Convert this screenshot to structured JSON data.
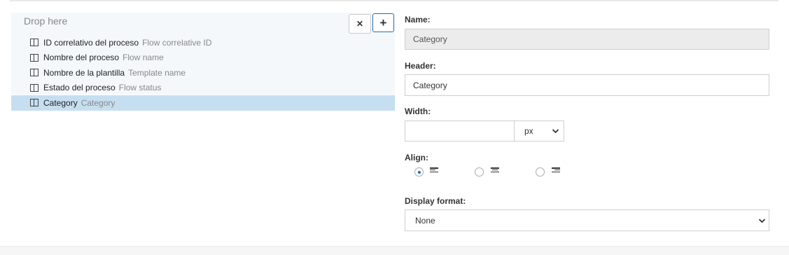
{
  "drop_area": {
    "placeholder": "Drop here"
  },
  "buttons": {
    "remove": "✕",
    "add": "+"
  },
  "columns": [
    {
      "name": "ID correlativo del proceso",
      "desc": "Flow correlative ID",
      "selected": false
    },
    {
      "name": "Nombre del proceso",
      "desc": "Flow name",
      "selected": false
    },
    {
      "name": "Nombre de la plantilla",
      "desc": "Template name",
      "selected": false
    },
    {
      "name": "Estado del proceso",
      "desc": "Flow status",
      "selected": false
    },
    {
      "name": "Category",
      "desc": "Category",
      "selected": true
    }
  ],
  "form": {
    "name_label": "Name:",
    "name_value": "Category",
    "header_label": "Header:",
    "header_value": "Category",
    "width_label": "Width:",
    "width_value": "",
    "width_unit": "px",
    "align_label": "Align:",
    "align_selected": "left",
    "display_format_label": "Display format:",
    "display_format_value": "None"
  },
  "colors": {
    "selected_row": "#c6dff0",
    "accent": "#1a6fb5"
  },
  "icons": [
    "column-icon",
    "close-icon",
    "plus-icon",
    "align-left-icon",
    "align-center-icon",
    "align-right-icon",
    "chevron-down-icon"
  ]
}
